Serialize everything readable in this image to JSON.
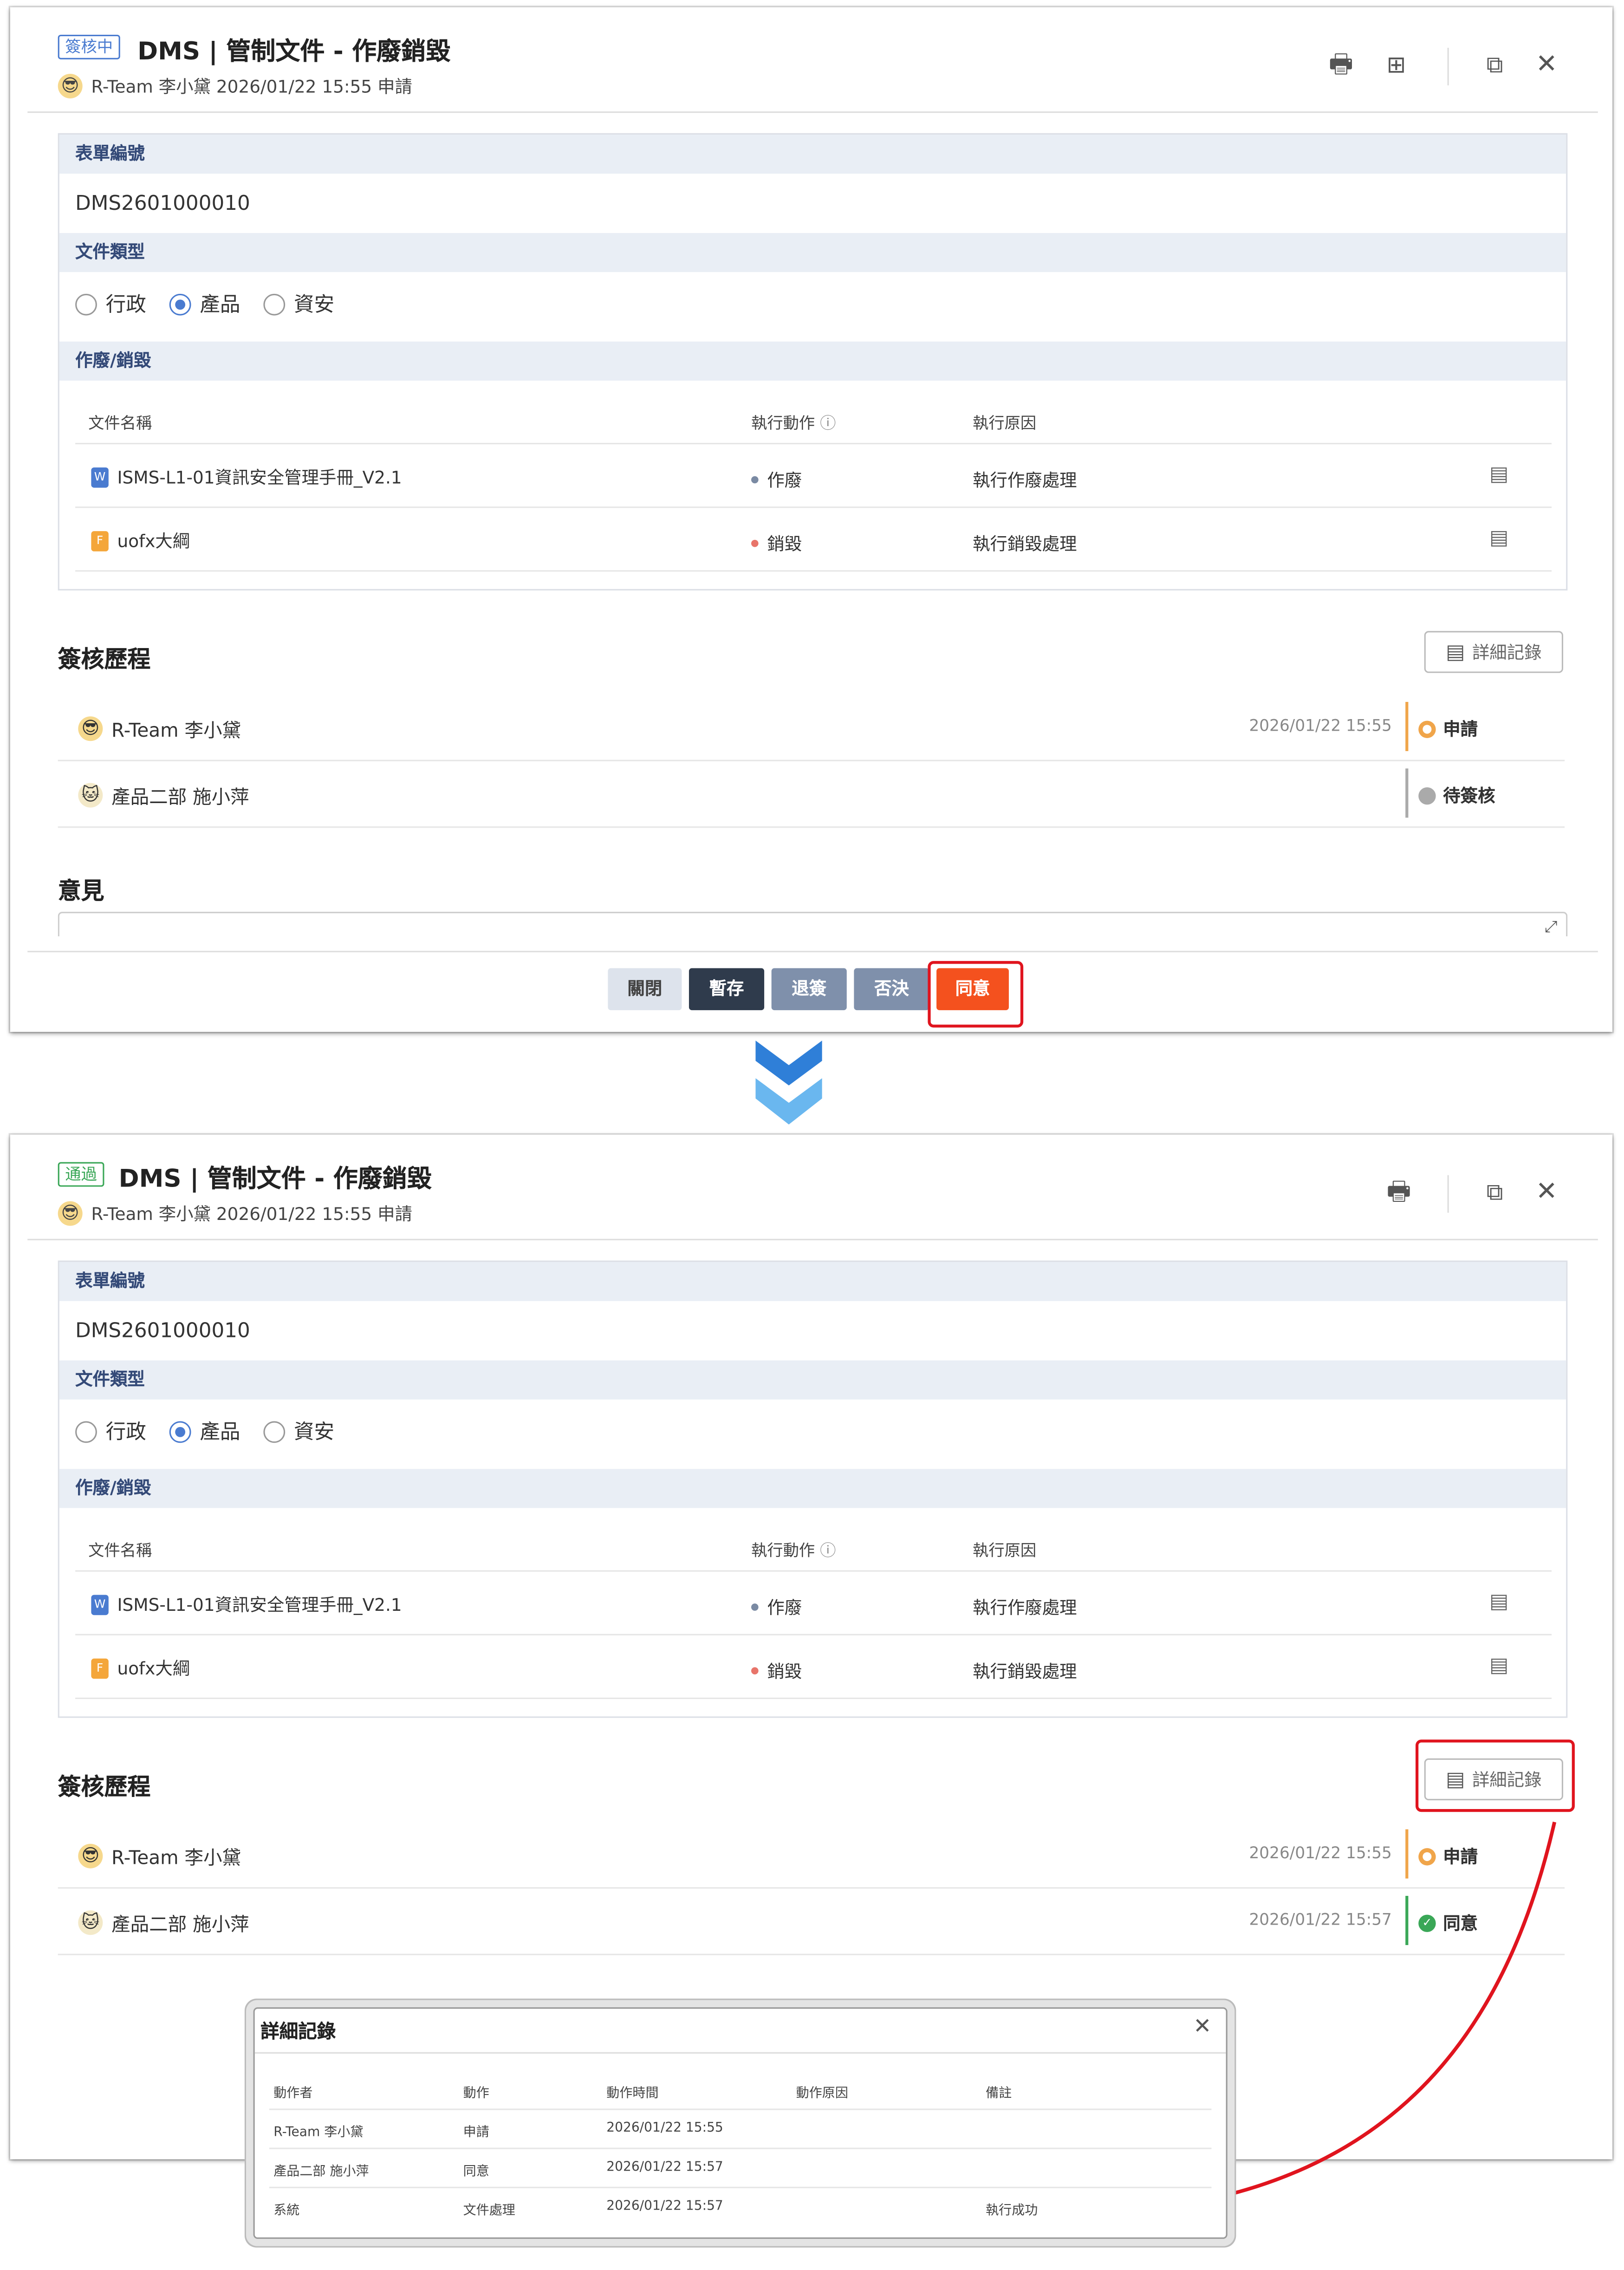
{
  "before": {
    "status_badge": "簽核中",
    "title": "DMS | 管制文件 - 作廢銷毀",
    "meta": "R-Team 李小黛  2026/01/22 15:55  申請",
    "history": [
      {
        "name": "R-Team 李小黛",
        "time": "2026/01/22 15:55",
        "action": "申請"
      },
      {
        "name": "產品二部 施小萍",
        "time": "",
        "action": "待簽核"
      }
    ],
    "opinion_heading": "意見",
    "buttons": {
      "close": "關閉",
      "save": "暫存",
      "return": "退簽",
      "reject": "否決",
      "approve": "同意"
    }
  },
  "after": {
    "status_badge": "通過",
    "title": "DMS | 管制文件 - 作廢銷毀",
    "meta": "R-Team 李小黛  2026/01/22 15:55  申請",
    "history": [
      {
        "name": "R-Team 李小黛",
        "time": "2026/01/22 15:55",
        "action": "申請"
      },
      {
        "name": "產品二部 施小萍",
        "time": "2026/01/22 15:57",
        "action": "同意"
      }
    ]
  },
  "form": {
    "form_no_label": "表單編號",
    "form_no_value": "DMS2601000010",
    "doc_type_label": "文件類型",
    "doc_type_options": [
      "行政",
      "產品",
      "資安"
    ],
    "doc_type_selected": "產品",
    "void_section_label": "作廢/銷毀",
    "columns": {
      "name": "文件名稱",
      "action": "執行動作",
      "reason": "執行原因"
    },
    "rows": [
      {
        "name": "ISMS-L1-01資訊安全管理手冊_V2.1",
        "action": "作廢",
        "reason": "執行作廢處理"
      },
      {
        "name": "uofx大綱",
        "action": "銷毀",
        "reason": "執行銷毀處理"
      }
    ]
  },
  "history_heading": "簽核歷程",
  "detail_button_label": "詳細記錄",
  "modal": {
    "title": "詳細記錄",
    "columns": [
      "動作者",
      "動作",
      "動作時間",
      "動作原因",
      "備註"
    ],
    "rows": [
      [
        "R-Team 李小黛",
        "申請",
        "2026/01/22 15:55",
        "",
        ""
      ],
      [
        "產品二部 施小萍",
        "同意",
        "2026/01/22 15:57",
        "",
        ""
      ],
      [
        "系統",
        "文件處理",
        "2026/01/22 15:57",
        "",
        "執行成功"
      ]
    ]
  },
  "colors": {
    "pending_badge": "#4a7bd0",
    "passed_badge": "#3aa757",
    "approve_button": "#f4511e",
    "highlight": "#e0141e",
    "chevron": "#4aa3e8"
  }
}
